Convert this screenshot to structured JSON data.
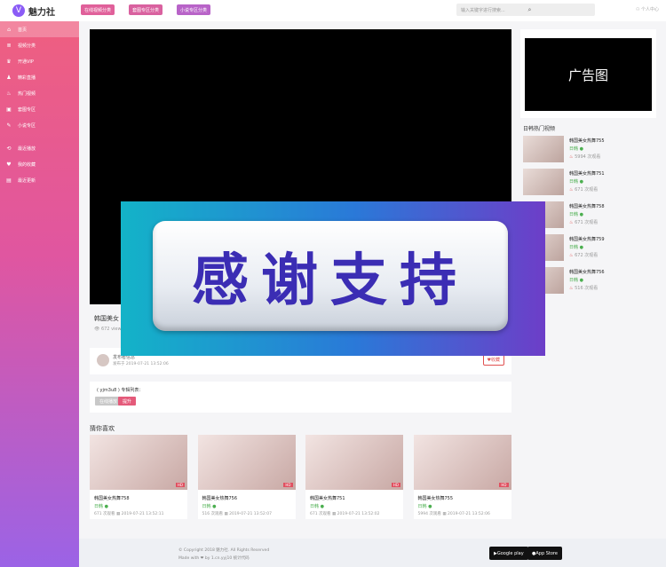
{
  "brand": {
    "logo_letter": "V",
    "name": "魅力社"
  },
  "sidebar": {
    "items": [
      {
        "icon": "⌂",
        "label": "首页",
        "active": true
      },
      {
        "icon": "≣",
        "label": "视频分类"
      },
      {
        "icon": "♛",
        "label": "开通VIP"
      },
      {
        "icon": "♟",
        "label": "精彩直播"
      },
      {
        "icon": "♨",
        "label": "热门视频"
      },
      {
        "icon": "▣",
        "label": "套图专区"
      },
      {
        "icon": "✎",
        "label": "小说专区"
      },
      {
        "icon": "⟲",
        "label": "最近播放"
      },
      {
        "icon": "♥",
        "label": "我的收藏"
      },
      {
        "icon": "▤",
        "label": "最近更新"
      }
    ]
  },
  "topbar": {
    "categories": [
      "在线视频分类",
      "套图专区分类",
      "小说专区分类"
    ],
    "search_placeholder": "输入关键字进行搜索...",
    "login": "个人中心"
  },
  "ad": {
    "label": "广告图"
  },
  "ranking": {
    "title": "日韩热门视频",
    "items": [
      {
        "name": "韩国美女热舞755",
        "tag": "日韩",
        "views": "5994 次观看"
      },
      {
        "name": "韩国美女热舞751",
        "tag": "日韩",
        "views": "671 次观看"
      },
      {
        "name": "韩国美女热舞758",
        "tag": "日韩",
        "views": "671 次观看"
      },
      {
        "name": "韩国美女热舞759",
        "tag": "日韩",
        "views": "672 次观看"
      },
      {
        "name": "韩国美女热舞756",
        "tag": "日韩",
        "views": "516 次观看"
      }
    ]
  },
  "video": {
    "title": "韩国美女",
    "views": "672 views"
  },
  "author": {
    "name": "发布者信息",
    "date": "发布于 2019-07-21 13:52:06",
    "collect": "收藏"
  },
  "episodes": {
    "title": "( yjm3u8 ) 专辑列表：",
    "buttons": [
      "在线播放",
      "提升"
    ]
  },
  "recommend": {
    "title": "猜你喜欢",
    "cards": [
      {
        "name": "韩国美女热舞758",
        "tag": "日韩",
        "views": "671 次观看",
        "date": "2019-07-21 13:52:11"
      },
      {
        "name": "韩国美女热舞756",
        "tag": "日韩",
        "views": "516 次观看",
        "date": "2019-07-21 13:52:07"
      },
      {
        "name": "韩国美女热舞751",
        "tag": "日韩",
        "views": "671 次观看",
        "date": "2019-07-21 13:52:02"
      },
      {
        "name": "韩国美女热舞755",
        "tag": "日韩",
        "views": "5994 次观看",
        "date": "2019-07-21 13:52:06"
      }
    ]
  },
  "footer": {
    "copyright": "© Copyright 2018 魅力社. All Rights Reserved",
    "made": "Made with ❤ by 1.cn.yyj10 统计代码",
    "stores": [
      "Google play",
      "App Store"
    ]
  },
  "overlay": {
    "text": "感谢支持"
  }
}
